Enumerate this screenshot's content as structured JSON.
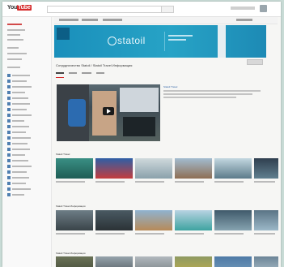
{
  "header": {
    "logo_you": "You",
    "logo_tube": "Tube"
  },
  "channel": {
    "brand": "statoil",
    "title": "Сотрудничество Statoil / Statoil Travel Информация"
  },
  "featured": {
    "title": "Statoil Travel"
  },
  "sections": [
    {
      "title": "Statoil Travel",
      "thumbs": 6
    },
    {
      "title": "Statoil Travel Информация",
      "thumbs": 6
    },
    {
      "title": "Statoil Travel Информация",
      "thumbs": 6
    }
  ],
  "colors": {
    "youtube_red": "#d62a2a",
    "banner_blue": "#1a8fbb"
  }
}
